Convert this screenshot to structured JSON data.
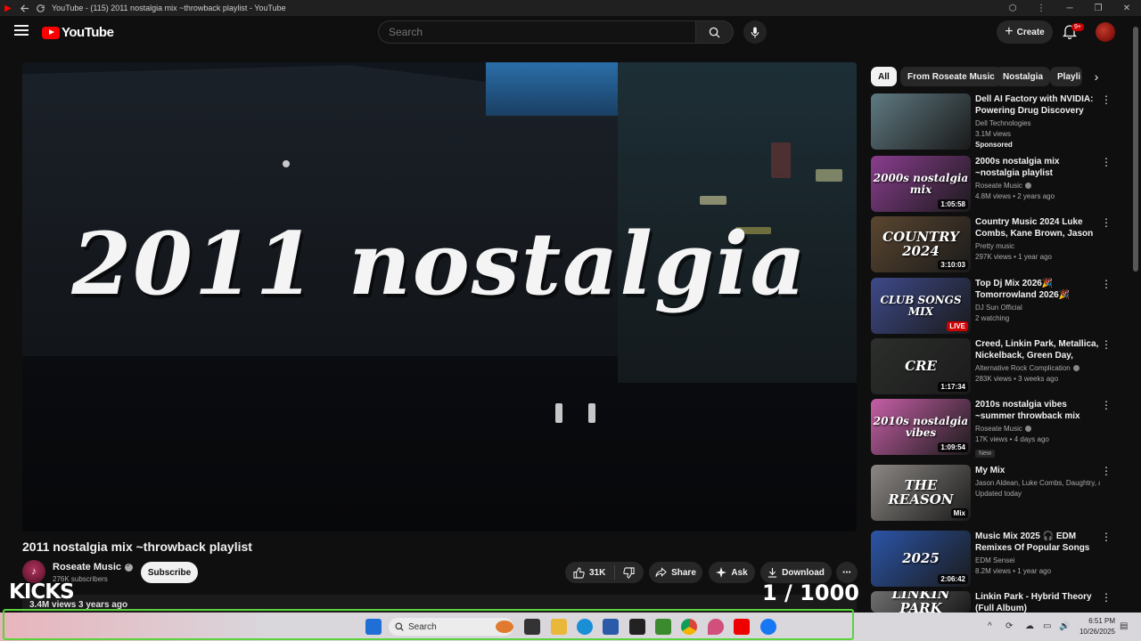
{
  "browser": {
    "tab_title": "YouTube - (115) 2011 nostalgia mix ~throwback playlist - YouTube"
  },
  "header": {
    "logo_text": "YouTube",
    "search_placeholder": "Search",
    "create_label": "Create",
    "notification_count": "9+"
  },
  "player": {
    "overlay_title": "2011 nostalgia"
  },
  "video": {
    "title": "2011 nostalgia mix ~throwback playlist",
    "channel": "Roseate Music",
    "subscribers": "276K subscribers",
    "subscribe_label": "Subscribe",
    "likes": "31K",
    "share_label": "Share",
    "ask_label": "Ask",
    "download_label": "Download",
    "views_line": "3.4M views  3 years ago"
  },
  "overlay": {
    "kicks_text": "KICKS",
    "counter_text": "1  / 1000"
  },
  "chips": [
    "All",
    "From Roseate Music",
    "Nostalgia",
    "Playli"
  ],
  "recommendations": [
    {
      "title": "Dell AI Factory with NVIDIA: Powering Drug Discovery",
      "channel": "Dell Technologies",
      "meta": "3.1M views",
      "tag": "Sponsored",
      "thumb_text": "",
      "duration": "",
      "thumb_color": "#5f7a82"
    },
    {
      "title": "2000s nostalgia mix ~nostalgia playlist",
      "channel": "Roseate Music",
      "meta": "4.8M views • 2 years ago",
      "thumb_text": "2000s nostalgia mix",
      "duration": "1:05:58",
      "thumb_color": "#8a3d8f"
    },
    {
      "title": "Country Music 2024 Luke Combs, Kane Brown, Jason ...",
      "channel": "Pretty music",
      "meta": "297K views • 1 year ago",
      "thumb_text": "COUNTRY 2024",
      "duration": "3:10:03",
      "thumb_color": "#5a4630"
    },
    {
      "title": "Top Dj Mix 2026🎉 Tomorrowland 2026🎉 Remixe...",
      "channel": "DJ Sun Official",
      "meta": "2 watching",
      "thumb_text": "CLUB SONGS MIX",
      "duration": "LIVE",
      "thumb_color": "#3e4a8a"
    },
    {
      "title": "Creed, Linkin Park, Metallica, Nickelback, Green Day, Coldpl...",
      "channel": "Alternative Rock Complication",
      "meta": "283K views • 3 weeks ago",
      "thumb_text": "CRE",
      "duration": "1:17:34",
      "thumb_color": "#2c2f2c"
    },
    {
      "title": "2010s nostalgia vibes ~summer throwback mix",
      "channel": "Roseate Music",
      "meta": "17K views • 4 days ago",
      "tag_new": "New",
      "thumb_text": "2010s nostalgia vibes",
      "duration": "1:09:54",
      "thumb_color": "#c65fa6"
    },
    {
      "title": "My Mix",
      "channel": "Jason Aldean, Luke Combs, Daughtry, an...",
      "meta": "Updated today",
      "thumb_text": "THE REASON",
      "duration": "Mix",
      "thumb_color": "#8c8884"
    },
    {
      "title": "Music Mix 2025 🎧 EDM Remixes Of Popular Songs 🎧 ...",
      "channel": "EDM Sensei",
      "meta": "8.2M views • 1 year ago",
      "thumb_text": "2025",
      "duration": "2:06:42",
      "thumb_color": "#2b55a8"
    },
    {
      "title": "Linkin Park - Hybrid Theory (Full Album)",
      "channel": "",
      "meta": "",
      "thumb_text": "LINKIN PARK",
      "duration": "",
      "thumb_color": "#6f6f6f"
    }
  ],
  "taskbar": {
    "search_label": "Search",
    "time": "6:51 PM",
    "date": "10/26/2025"
  }
}
